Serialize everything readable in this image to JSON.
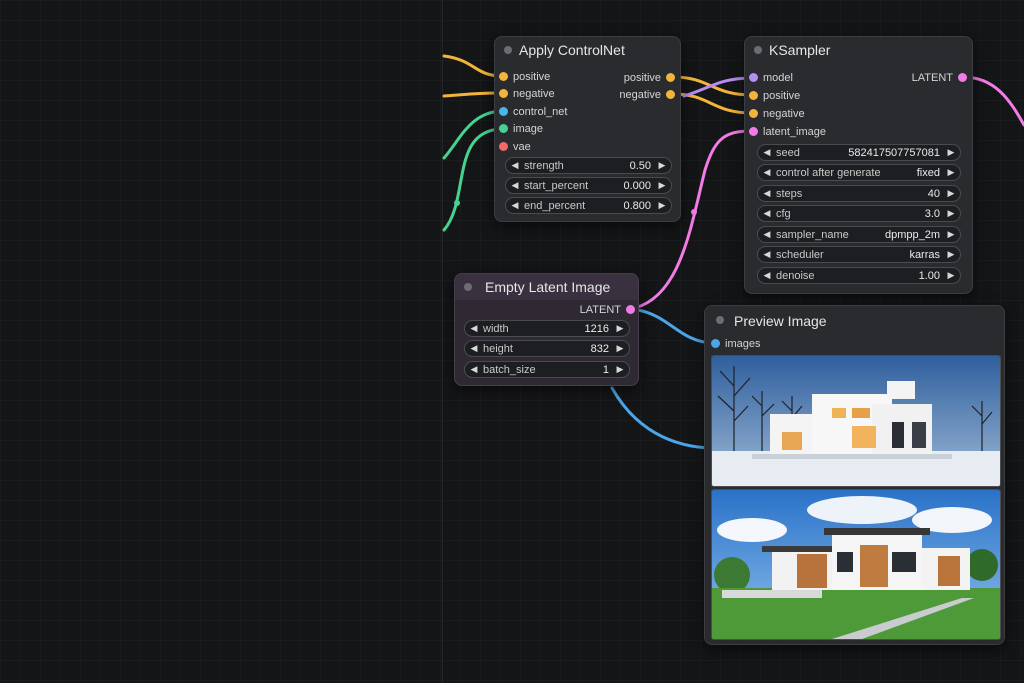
{
  "nodes": {
    "apply_controlnet": {
      "title": "Apply ControlNet",
      "inputs": [
        "positive",
        "negative",
        "control_net",
        "image",
        "vae"
      ],
      "outputs": [
        "positive",
        "negative"
      ],
      "widgets": [
        {
          "label": "strength",
          "value": "0.50"
        },
        {
          "label": "start_percent",
          "value": "0.000"
        },
        {
          "label": "end_percent",
          "value": "0.800"
        }
      ]
    },
    "ksampler": {
      "title": "KSampler",
      "inputs": [
        "model",
        "positive",
        "negative",
        "latent_image"
      ],
      "outputs": [
        "LATENT"
      ],
      "widgets": [
        {
          "label": "seed",
          "value": "582417507757081"
        },
        {
          "label": "control after generate",
          "value": "fixed"
        },
        {
          "label": "steps",
          "value": "40"
        },
        {
          "label": "cfg",
          "value": "3.0"
        },
        {
          "label": "sampler_name",
          "value": "dpmpp_2m"
        },
        {
          "label": "scheduler",
          "value": "karras"
        },
        {
          "label": "denoise",
          "value": "1.00"
        }
      ]
    },
    "empty_latent": {
      "title": "Empty Latent Image",
      "outputs": [
        "LATENT"
      ],
      "widgets": [
        {
          "label": "width",
          "value": "1216"
        },
        {
          "label": "height",
          "value": "832"
        },
        {
          "label": "batch_size",
          "value": "1"
        }
      ]
    },
    "preview_image": {
      "title": "Preview Image",
      "inputs": [
        "images"
      ],
      "images": [
        "snowy-modern-house-photo",
        "summer-modern-house-photo"
      ]
    }
  },
  "colors": {
    "conditioning": "#f2b43a",
    "control_net": "#49b6e8",
    "image": "#46d392",
    "vae": "#f06a6a",
    "model": "#b58cf0",
    "latent": "#f27ce6",
    "images": "#4ba6e8",
    "node_bg": "#2a2b2e",
    "canvas_bg": "#141517"
  },
  "icons": {
    "decrement": "◀",
    "increment": "▶"
  }
}
